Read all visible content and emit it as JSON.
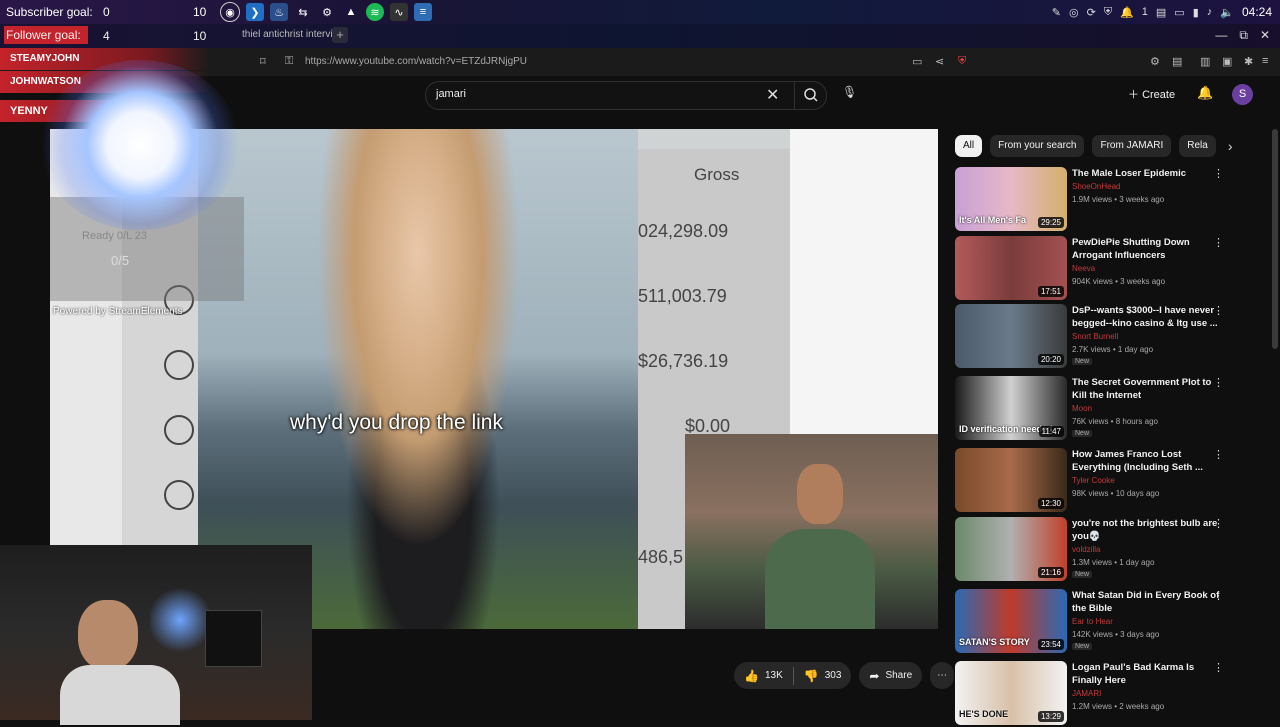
{
  "taskbar": {
    "subscriber_goal": {
      "label": "Subscriber goal:",
      "current": "0",
      "target": "10"
    },
    "follower_goal": {
      "label": "Follower goal:",
      "current": "4",
      "target": "10"
    },
    "clock": "04:24",
    "tray_count": "1",
    "icons": [
      "obs-icon",
      "vscode-icon",
      "steam-icon",
      "terminal-icon",
      "settings-icon",
      "inkscape-icon",
      "spotify-icon",
      "monitor-icon",
      "notes-icon"
    ]
  },
  "browser": {
    "tab_title": "thiel antichrist interview",
    "url": "https://www.youtube.com/watch?v=ETZdJRNjgPU"
  },
  "stream_overlay": {
    "chatters": [
      "STEAMYJOHN",
      "JOHNWATSON",
      "YENNY"
    ],
    "ready_label": "Ready 0/L 23",
    "counter": "0/5",
    "powered_by": "Powered by StreamElements"
  },
  "youtube": {
    "search_value": "jamari",
    "create_label": "Create",
    "avatar_initial": "S"
  },
  "video": {
    "caption": "why'd you drop the link",
    "table_header": "Gross",
    "table_values": [
      "024,298.09",
      "511,003.79",
      "$26,736.19",
      "$0.00",
      "486,5"
    ]
  },
  "actions": {
    "likes": "13K",
    "dislikes": "303",
    "share_label": "Share"
  },
  "sidebar": {
    "chips": [
      "All",
      "From your search",
      "From JAMARI",
      "Rela"
    ],
    "recommendations": [
      {
        "title": "The Male Loser Epidemic",
        "channel": "ShoeOnHead",
        "meta": "1.9M views • 3 weeks ago",
        "duration": "29:25",
        "new": "",
        "thumb_text": "It's All Men's Fa"
      },
      {
        "title": "PewDiePie Shutting Down Arrogant Influencers",
        "channel": "Neeva",
        "meta": "904K views • 3 weeks ago",
        "duration": "17:51",
        "new": "",
        "thumb_text": ""
      },
      {
        "title": "DsP--wants $3000--I have never begged--kino casino & Itg use ...",
        "channel": "Snort Burnell",
        "meta": "2.7K views • 1 day ago",
        "duration": "20:20",
        "new": "New",
        "thumb_text": ""
      },
      {
        "title": "The Secret Government Plot to Kill the Internet",
        "channel": "Moon",
        "meta": "76K views • 8 hours ago",
        "duration": "11:47",
        "new": "New",
        "thumb_text": "ID verification needed"
      },
      {
        "title": "How James Franco Lost Everything (Including Seth ...",
        "channel": "Tyler Cooke",
        "meta": "98K views • 10 days ago",
        "duration": "12:30",
        "new": "",
        "thumb_text": ""
      },
      {
        "title": "you're not the brightest bulb are you💀",
        "channel": "voldzilla",
        "meta": "1.3M views • 1 day ago",
        "duration": "21:16",
        "new": "New",
        "thumb_text": ""
      },
      {
        "title": "What Satan Did in Every Book of the Bible",
        "channel": "Ear to Hear",
        "meta": "142K views • 3 days ago",
        "duration": "23:54",
        "new": "New",
        "thumb_text": "SATAN'S STORY"
      },
      {
        "title": "Logan Paul's Bad Karma Is Finally Here",
        "channel": "JAMARI",
        "meta": "1.2M views • 2 weeks ago",
        "duration": "13:29",
        "new": "",
        "thumb_text": "HE'S DONE"
      }
    ]
  },
  "colors": {
    "accent": "#c4232b",
    "yt_bg": "#0f0f0f",
    "avatar": "#6b3fa0"
  }
}
